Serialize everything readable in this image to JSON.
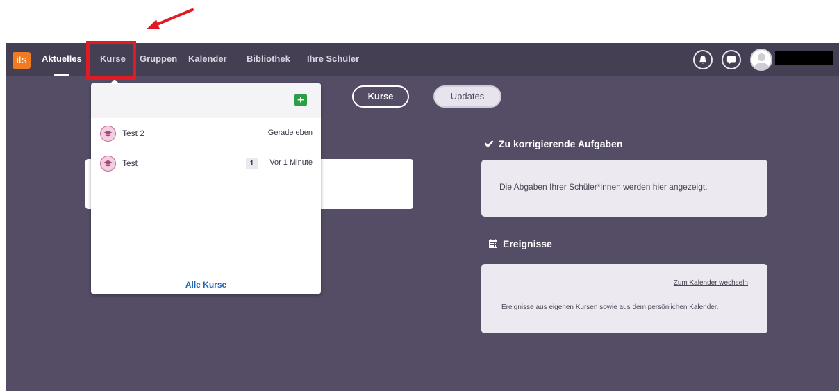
{
  "app": {
    "logo_text": "its",
    "accent_color": "#f07b22",
    "topbar_color": "#453f53",
    "background_color": "#554d66"
  },
  "nav": {
    "items": [
      {
        "label": "Aktuelles",
        "active": true
      },
      {
        "label": "Kurse",
        "active": false
      },
      {
        "label": "Gruppen",
        "active": false
      },
      {
        "label": "Kalender",
        "active": false
      },
      {
        "label": "Bibliothek",
        "active": false
      },
      {
        "label": "Ihre Schüler",
        "active": false
      }
    ]
  },
  "header_icons": {
    "notifications": "bell-icon",
    "messages": "speech-bubble-icon",
    "profile": "avatar-icon"
  },
  "toggle": {
    "primary": "Kurse",
    "secondary": "Updates"
  },
  "dropdown": {
    "add_icon": "plus-icon",
    "courses": [
      {
        "name": "Test 2",
        "time": "Gerade eben",
        "count": null,
        "icon": "graduation-cap-icon"
      },
      {
        "name": "Test",
        "time": "Vor 1 Minute",
        "count": "1",
        "icon": "graduation-cap-icon"
      }
    ],
    "footer_link": "Alle Kurse",
    "link_color": "#2366b5"
  },
  "grading": {
    "title": "Zu korrigierende Aufgaben",
    "icon": "checkmark-icon",
    "empty_text": "Die Abgaben Ihrer Schüler*innen werden hier angezeigt."
  },
  "events": {
    "title": "Ereignisse",
    "icon": "calendar-icon",
    "calendar_link": "Zum Kalender wechseln",
    "empty_text": "Ereignisse aus eigenen Kursen sowie aus dem persönlichen Kalender."
  },
  "annotation": {
    "highlight_color": "#e01b24"
  }
}
